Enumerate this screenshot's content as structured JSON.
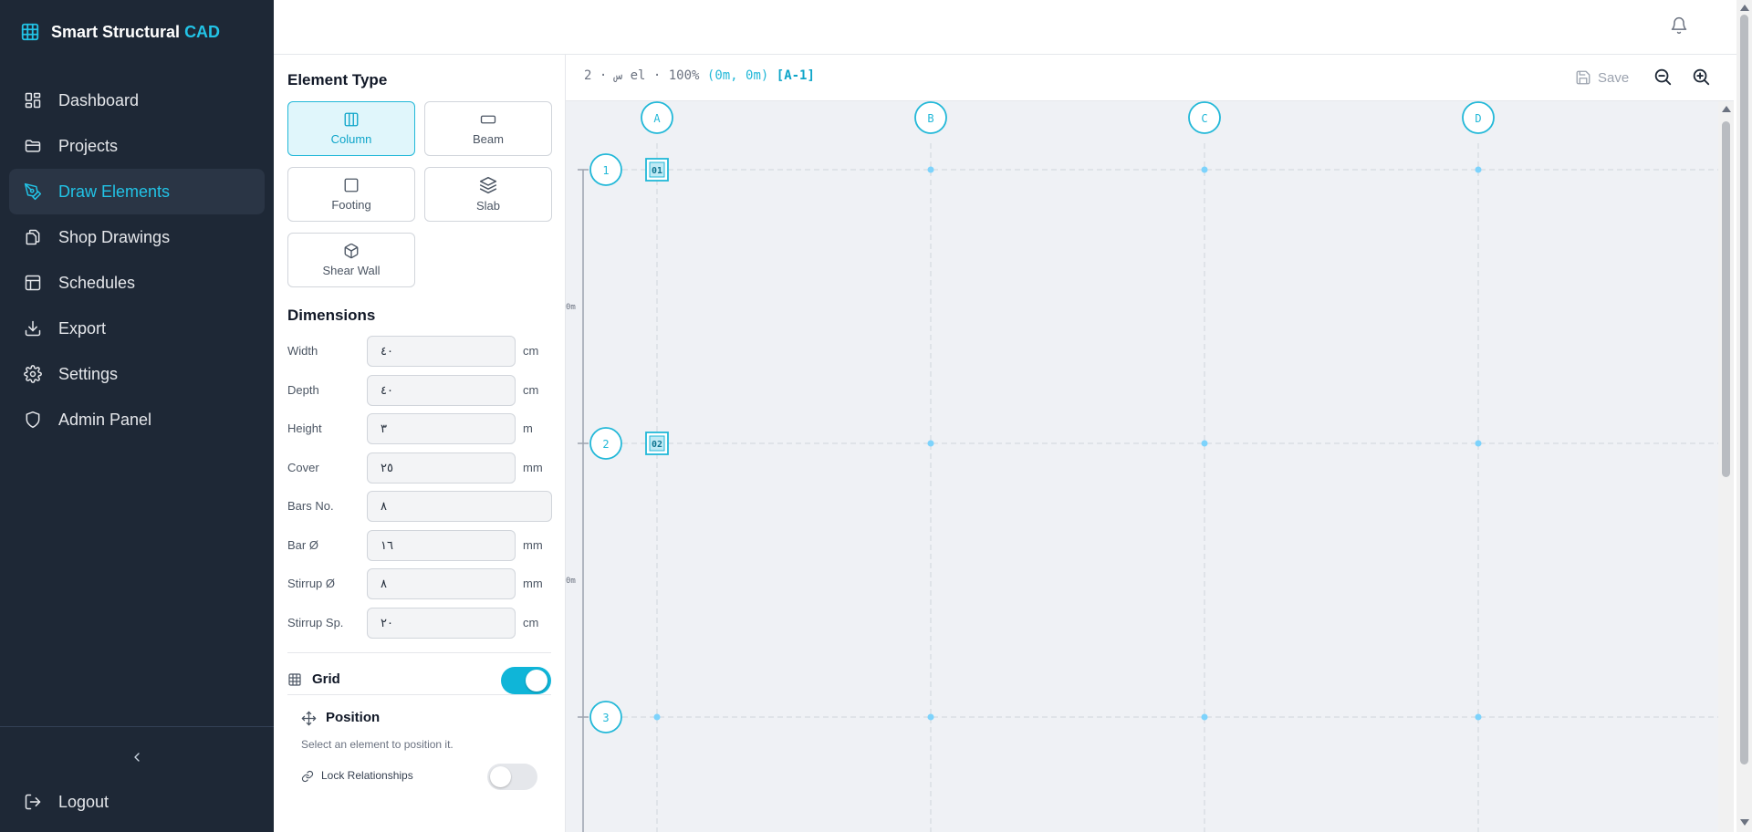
{
  "app": {
    "brand_main": "Smart Structural",
    "brand_accent": "CAD",
    "accent_color": "#22c3e6"
  },
  "sidebar": {
    "items": [
      {
        "label": "Dashboard",
        "icon": "dashboard-icon"
      },
      {
        "label": "Projects",
        "icon": "folder-icon"
      },
      {
        "label": "Draw Elements",
        "icon": "pen-tool-icon",
        "active": true
      },
      {
        "label": "Shop Drawings",
        "icon": "files-icon"
      },
      {
        "label": "Schedules",
        "icon": "table-icon"
      },
      {
        "label": "Export",
        "icon": "download-icon"
      },
      {
        "label": "Settings",
        "icon": "gear-icon"
      },
      {
        "label": "Admin Panel",
        "icon": "shield-icon"
      }
    ],
    "logout": "Logout"
  },
  "panel": {
    "element_type_title": "Element Type",
    "types": [
      {
        "label": "Column",
        "icon": "column-icon",
        "selected": true
      },
      {
        "label": "Beam",
        "icon": "beam-icon"
      },
      {
        "label": "Footing",
        "icon": "square-icon"
      },
      {
        "label": "Slab",
        "icon": "layers-icon"
      },
      {
        "label": "Shear Wall",
        "icon": "box-icon"
      }
    ],
    "dimensions_title": "Dimensions",
    "dimensions": {
      "width": {
        "label": "Width",
        "value": "٤٠",
        "unit": "cm"
      },
      "depth": {
        "label": "Depth",
        "value": "٤٠",
        "unit": "cm"
      },
      "height": {
        "label": "Height",
        "value": "٣",
        "unit": "m"
      },
      "cover": {
        "label": "Cover",
        "value": "٢٥",
        "unit": "mm"
      },
      "bars_no": {
        "label": "Bars No.",
        "value": "٨"
      },
      "bar_dia": {
        "label": "Bar Ø",
        "value": "١٦",
        "unit": "mm"
      },
      "stirrup_dia": {
        "label": "Stirrup Ø",
        "value": "٨",
        "unit": "mm"
      },
      "stirrup_sp": {
        "label": "Stirrup Sp.",
        "value": "٢٠",
        "unit": "cm"
      }
    },
    "grid": {
      "label": "Grid",
      "enabled": true
    },
    "position": {
      "title": "Position",
      "hint": "Select an element to position it.",
      "lock_label": "Lock Relationships",
      "lock_enabled": false
    }
  },
  "canvas": {
    "status_prefix": "2 · س el · 100%",
    "coords": "(0m, 0m)",
    "selection": "[A-1]",
    "save_label": "Save",
    "zoom_out_icon": "zoom-out-icon",
    "zoom_in_icon": "zoom-in-icon",
    "columns": [
      "A",
      "B",
      "C",
      "D"
    ],
    "rows": [
      "1",
      "2",
      "3"
    ],
    "spacing_labels": [
      "0m",
      "0m"
    ],
    "elements": [
      {
        "label": "01",
        "grid": "A-1"
      },
      {
        "label": "02",
        "grid": "A-2"
      }
    ],
    "grid_color": "#22b8d8"
  }
}
